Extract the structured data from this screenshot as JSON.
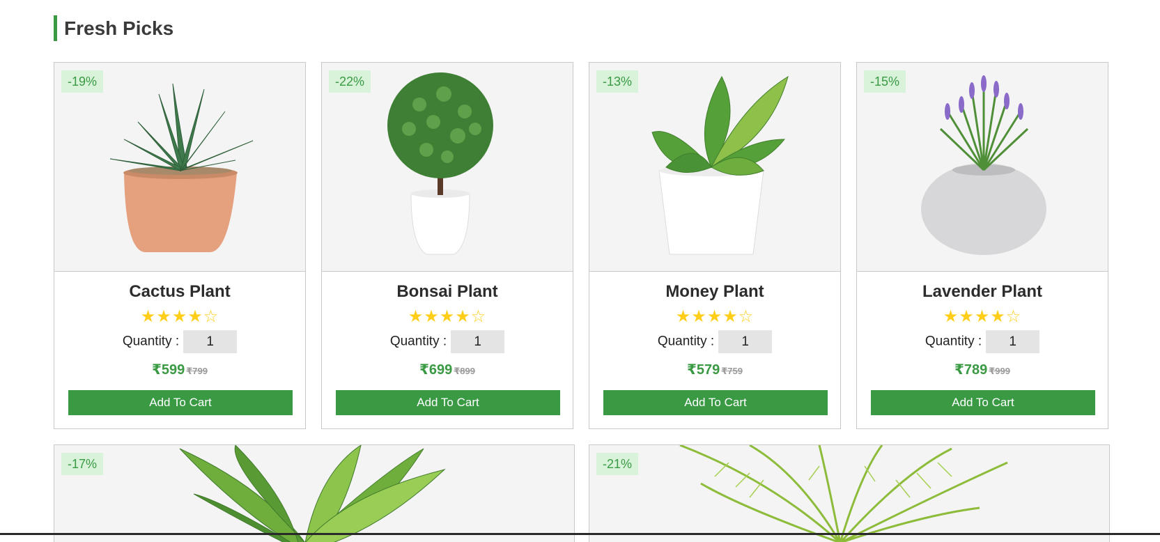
{
  "section": {
    "title": "Fresh Picks"
  },
  "products": [
    {
      "discount": "-19%",
      "name": "Cactus Plant",
      "rating": 4,
      "quantity_label": "Quantity :",
      "quantity": "1",
      "price": "₹599",
      "old_price": "₹799",
      "button": "Add To Cart",
      "image": "cactus-plant-image"
    },
    {
      "discount": "-22%",
      "name": "Bonsai Plant",
      "rating": 4,
      "quantity_label": "Quantity :",
      "quantity": "1",
      "price": "₹699",
      "old_price": "₹899",
      "button": "Add To Cart",
      "image": "bonsai-plant-image"
    },
    {
      "discount": "-13%",
      "name": "Money Plant",
      "rating": 4,
      "quantity_label": "Quantity :",
      "quantity": "1",
      "price": "₹579",
      "old_price": "₹759",
      "button": "Add To Cart",
      "image": "money-plant-image"
    },
    {
      "discount": "-15%",
      "name": "Lavender Plant",
      "rating": 4,
      "quantity_label": "Quantity :",
      "quantity": "1",
      "price": "₹789",
      "old_price": "₹999",
      "button": "Add To Cart",
      "image": "lavender-plant-image"
    }
  ],
  "featured": [
    {
      "discount": "-17%",
      "image": "dieffenbachia-plant-image"
    },
    {
      "discount": "-21%",
      "image": "palm-plant-image"
    }
  ],
  "colors": {
    "accent": "#3a9a44",
    "badge_bg": "#d8f3d9",
    "star": "#ffce1a"
  }
}
